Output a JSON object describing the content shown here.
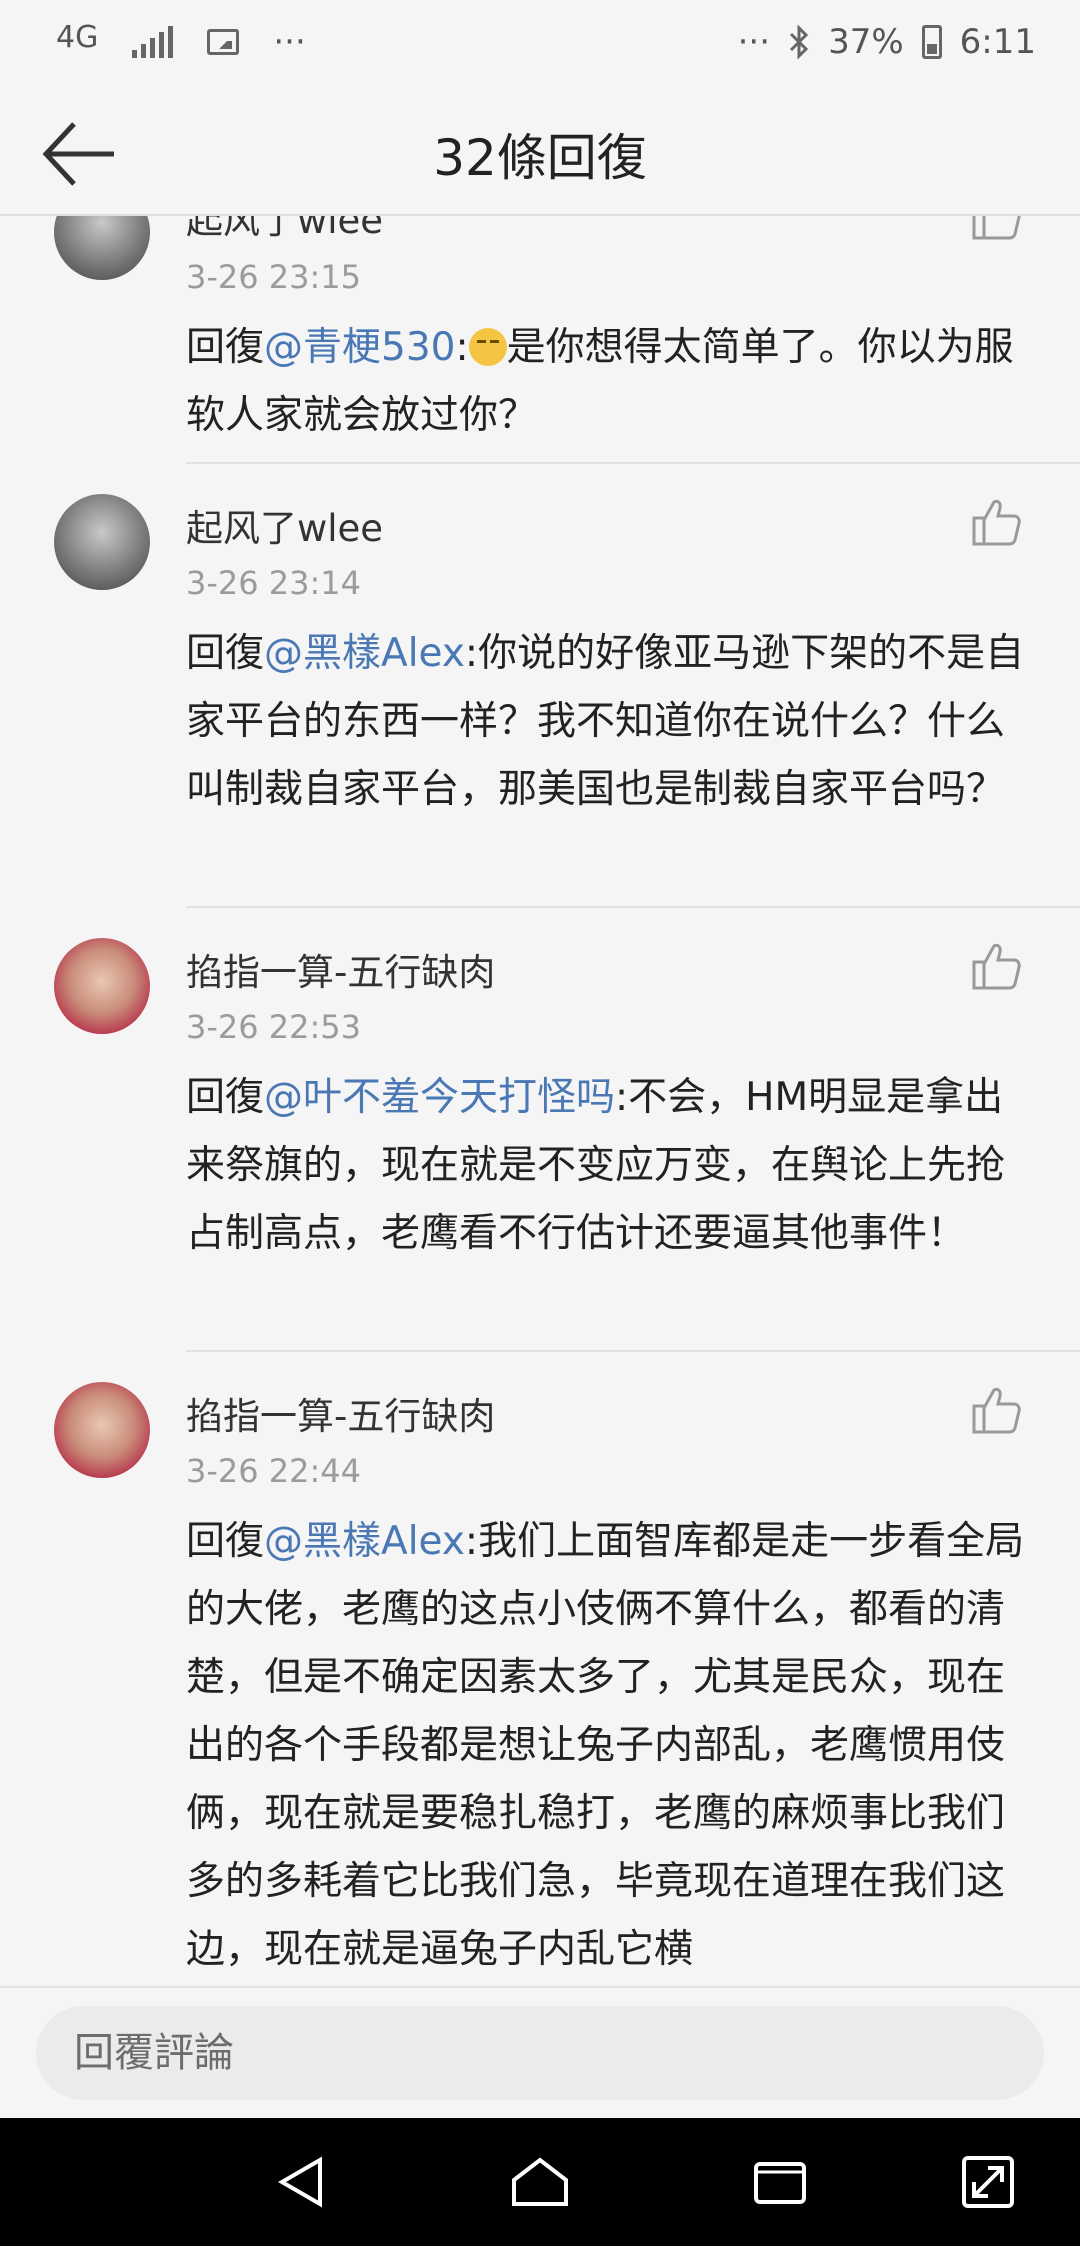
{
  "status_bar": {
    "network": "4G",
    "dots_left": "···",
    "dots_right": "···",
    "battery": "37%",
    "time": "6:11"
  },
  "header": {
    "title": "32條回復",
    "back_icon": "arrow-left-icon"
  },
  "comments": [
    {
      "user": "起风了wlee",
      "time": "3-26 23:15",
      "reply_prefix": "回復",
      "mention": "@青梗530",
      "sep": ":",
      "emoji": "smirk-emoji",
      "text": "是你想得太简单了。你以为服软人家就会放过你？"
    },
    {
      "user": "起风了wlee",
      "time": "3-26 23:14",
      "reply_prefix": "回復",
      "mention": "@黑樣Alex",
      "sep": ":",
      "text": "你说的好像亚马逊下架的不是自家平台的东西一样？我不知道你在说什么？什么叫制裁自家平台，那美国也是制裁自家平台吗？"
    },
    {
      "user": "掐指一算-五行缺肉",
      "time": "3-26 22:53",
      "reply_prefix": "回復",
      "mention": "@叶不羞今天打怪吗",
      "sep": ":",
      "text": "不会，HM明显是拿出来祭旗的，现在就是不变应万变，在舆论上先抢占制高点，老鹰看不行估计还要逼其他事件！"
    },
    {
      "user": "掐指一算-五行缺肉",
      "time": "3-26 22:44",
      "reply_prefix": "回復",
      "mention": "@黑樣Alex",
      "sep": ":",
      "text": "我们上面智库都是走一步看全局的大佬，老鹰的这点小伎俩不算什么，都看的清楚，但是不确定因素太多了，尤其是民众，现在出的各个手段都是想让兔子内部乱，老鹰惯用伎俩，现在就是要稳扎稳打，老鹰的麻烦事比我们多的多耗着它比我们急，毕竟现在道理在我们这边，现在就是逼兔子内乱它横"
    }
  ],
  "reply_bar": {
    "placeholder": "回覆評論"
  },
  "nav": [
    "back-triangle-icon",
    "home-icon",
    "recents-icon",
    "expand-icon"
  ]
}
